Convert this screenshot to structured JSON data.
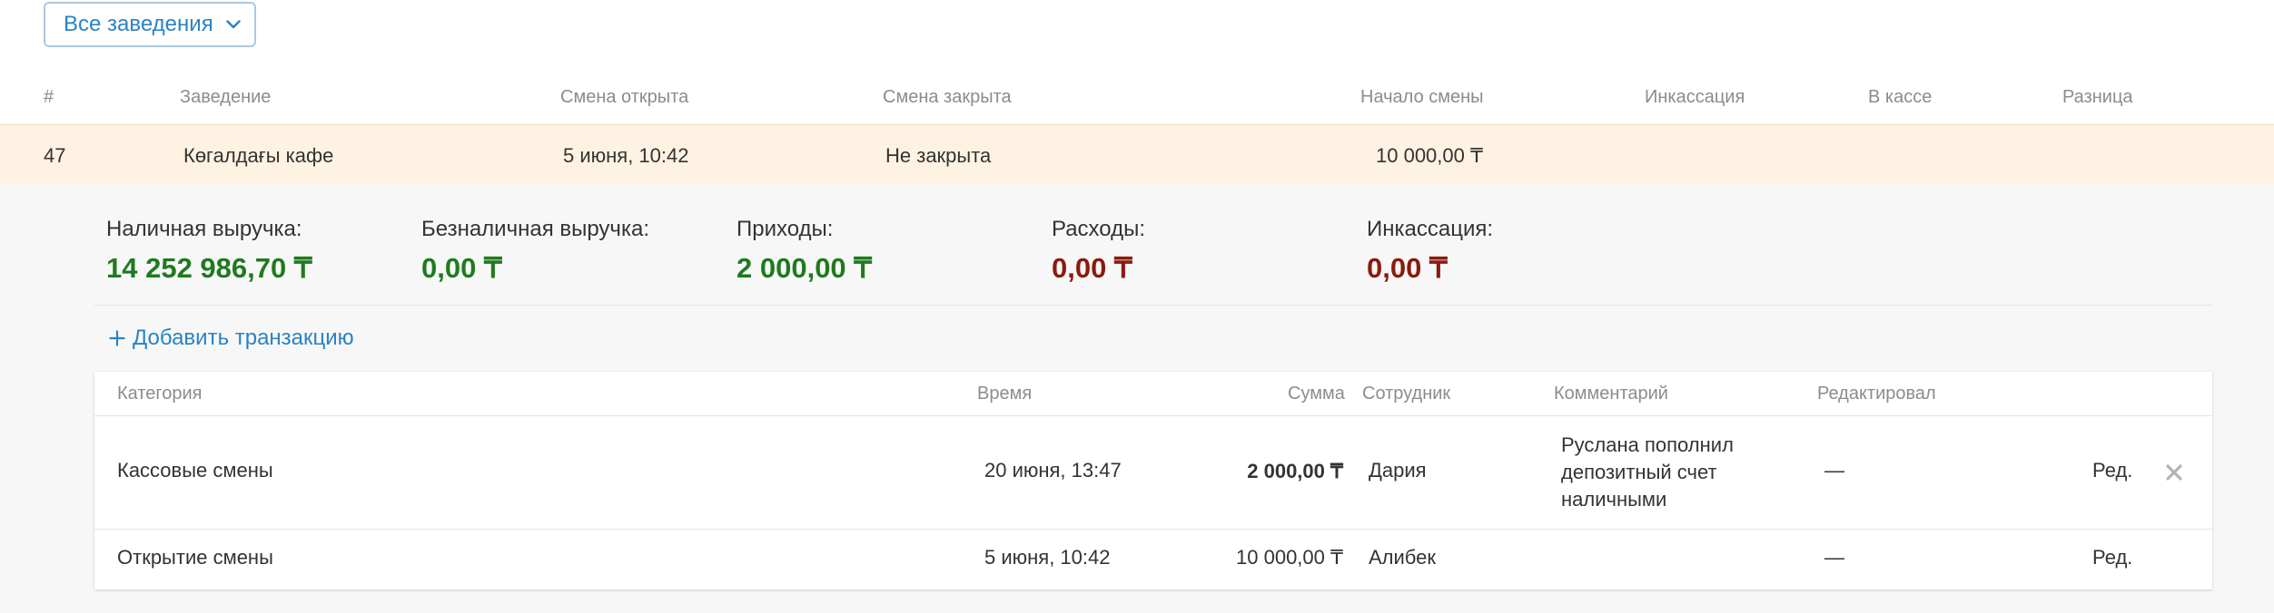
{
  "venue_filter": {
    "label": "Все заведения",
    "icon": "chevron-down-icon"
  },
  "shifts_table": {
    "headers": [
      "#",
      "Заведение",
      "Смена открыта",
      "Смена закрыта",
      "Начало смены",
      "Инкассация",
      "В кассе",
      "Разница"
    ],
    "row": {
      "id": "47",
      "venue": "Көгалдағы кафе",
      "opened": "5 июня, 10:42",
      "closed": "Не закрыта",
      "start_amount": "10 000,00 ₸",
      "collection": "",
      "in_register": "",
      "difference": ""
    }
  },
  "summary": [
    {
      "label": "Наличная выручка:",
      "value": "14 252 986,70 ₸",
      "tone": "positive"
    },
    {
      "label": "Безналичная выручка:",
      "value": "0,00 ₸",
      "tone": "positive"
    },
    {
      "label": "Приходы:",
      "value": "2 000,00 ₸",
      "tone": "positive"
    },
    {
      "label": "Расходы:",
      "value": "0,00 ₸",
      "tone": "negative"
    },
    {
      "label": "Инкассация:",
      "value": "0,00 ₸",
      "tone": "negative"
    }
  ],
  "add_transaction": {
    "label": "Добавить транзакцию",
    "icon": "plus-icon"
  },
  "transactions_table": {
    "headers": {
      "category": "Категория",
      "time": "Время",
      "amount": "Сумма",
      "employee": "Сотрудник",
      "comment": "Комментарий",
      "edited_by": "Редактировал"
    },
    "rows": [
      {
        "category": "Кассовые смены",
        "time": "20 июня, 13:47",
        "amount": "2 000,00 ₸",
        "employee": "Дария",
        "comment": "Руслана пополнил депозитный счет наличными",
        "edited_by": "—",
        "edit_label": "Ред.",
        "delete_icon": "close-icon"
      },
      {
        "category": "Открытие смены",
        "time": "5 июня, 10:42",
        "amount": "10 000,00 ₸",
        "employee": "Алибек",
        "comment": "",
        "edited_by": "—",
        "edit_label": "Ред."
      }
    ]
  },
  "colors": {
    "accent_blue": "#2a83c4",
    "positive_green": "#1f7a1f",
    "negative_red": "#8b1a0e",
    "highlight_row": "#fef3e2"
  }
}
